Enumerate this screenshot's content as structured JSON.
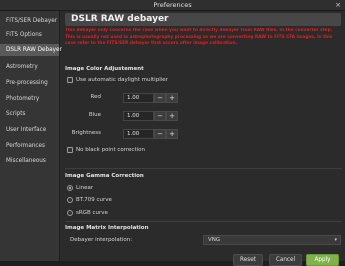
{
  "window": {
    "title": "Preferences",
    "close_glyph": "×"
  },
  "sidebar": {
    "items": [
      {
        "label": "FITS/SER Debayer"
      },
      {
        "label": "FITS Options"
      },
      {
        "label": "DSLR RAW Debayer"
      },
      {
        "label": "Astrometry"
      },
      {
        "label": "Pre-processing"
      },
      {
        "label": "Photometry"
      },
      {
        "label": "Scripts"
      },
      {
        "label": "User Interface"
      },
      {
        "label": "Performances"
      },
      {
        "label": "Miscellaneous"
      }
    ],
    "active_index": 2
  },
  "page": {
    "title": "DSLR RAW debayer",
    "warning": "This debayer only concerns the case when you want to directly debayer from RAW files. In the converter step. This is usually not used in astrophotography processing as we are converting RAW to FITS CFA images, in this case refer to the FITS/SER debayer that occurs after image calibration."
  },
  "color_adjustment": {
    "title": "Image Color Adjustement",
    "daylight_label": "Use automatic daylight multiplier",
    "red_label": "Red",
    "red_value": "1.00",
    "blue_label": "Blue",
    "blue_value": "1.00",
    "brightness_label": "Brightness",
    "brightness_value": "1.00",
    "minus_glyph": "−",
    "plus_glyph": "+",
    "black_point_label": "No black point correction"
  },
  "gamma": {
    "title": "Image Gamma Correction",
    "options": [
      "Linear",
      "BT.709 curve",
      "sRGB curve"
    ],
    "selected": "Linear"
  },
  "interpolation": {
    "title": "Image Matrix Interpolation",
    "label": "Debayer interpolation:",
    "value": "VNG",
    "arrow_glyph": "▾"
  },
  "buttons": {
    "reset": "Reset",
    "cancel": "Cancel",
    "apply": "Apply"
  },
  "colors": {
    "accent": "#7fb24a",
    "warning": "#e02020",
    "active_item": "#5a5a5a"
  }
}
